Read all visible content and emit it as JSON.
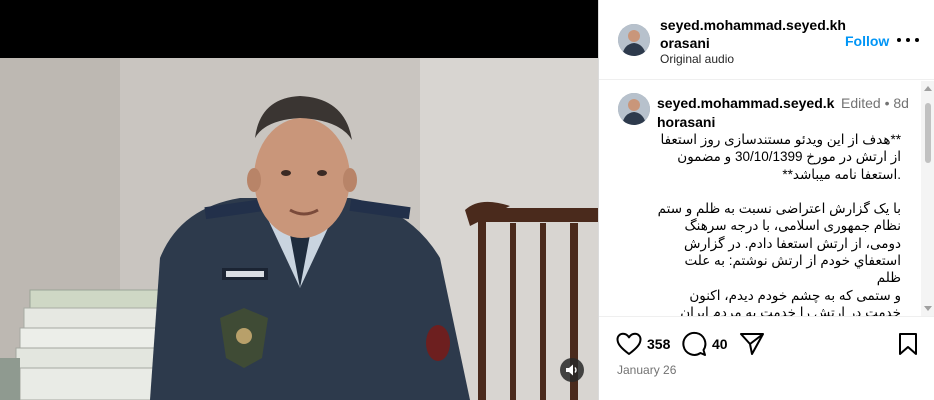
{
  "post": {
    "username": "seyed.mohammad.seyed.khorasani",
    "audio": "Original audio",
    "follow_label": "Follow"
  },
  "caption": {
    "username": "seyed.mohammad.seyed.khorasani",
    "meta": "Edited • 8d",
    "text": "**هدف از این ویدئو مستندسازی روز استعفا\nاز ارتش در مورخ 30/10/1399 و مضمون\n.استعفا نامه میباشد**\n\nبا یک گزارش اعتراضی نسبت به ظلم و ستم\nنظام جمهوری اسلامی، با درجه سرهنگ\nدومی، از ارتش استعفا دادم. در گزارش\nاستعفاي خودم از ارتش نوشتم: به علت ظلم\nو ستمی که به چشم خودم دیدم، اکنون\nخدمت در ارتش را خدمت به مردم ایران\nنمیدانم و به دلیل ظلم و ستم از ارتش"
  },
  "actions": {
    "likes": "358",
    "comments": "40",
    "date": "January 26"
  },
  "icons": {
    "more": "more-options-icon",
    "like": "heart-icon",
    "comment": "comment-icon",
    "share": "share-icon",
    "save": "bookmark-icon",
    "audio": "speaker-icon"
  },
  "colors": {
    "follow": "#0095f6",
    "muted_text": "#737373",
    "border": "#dbdbdb"
  }
}
